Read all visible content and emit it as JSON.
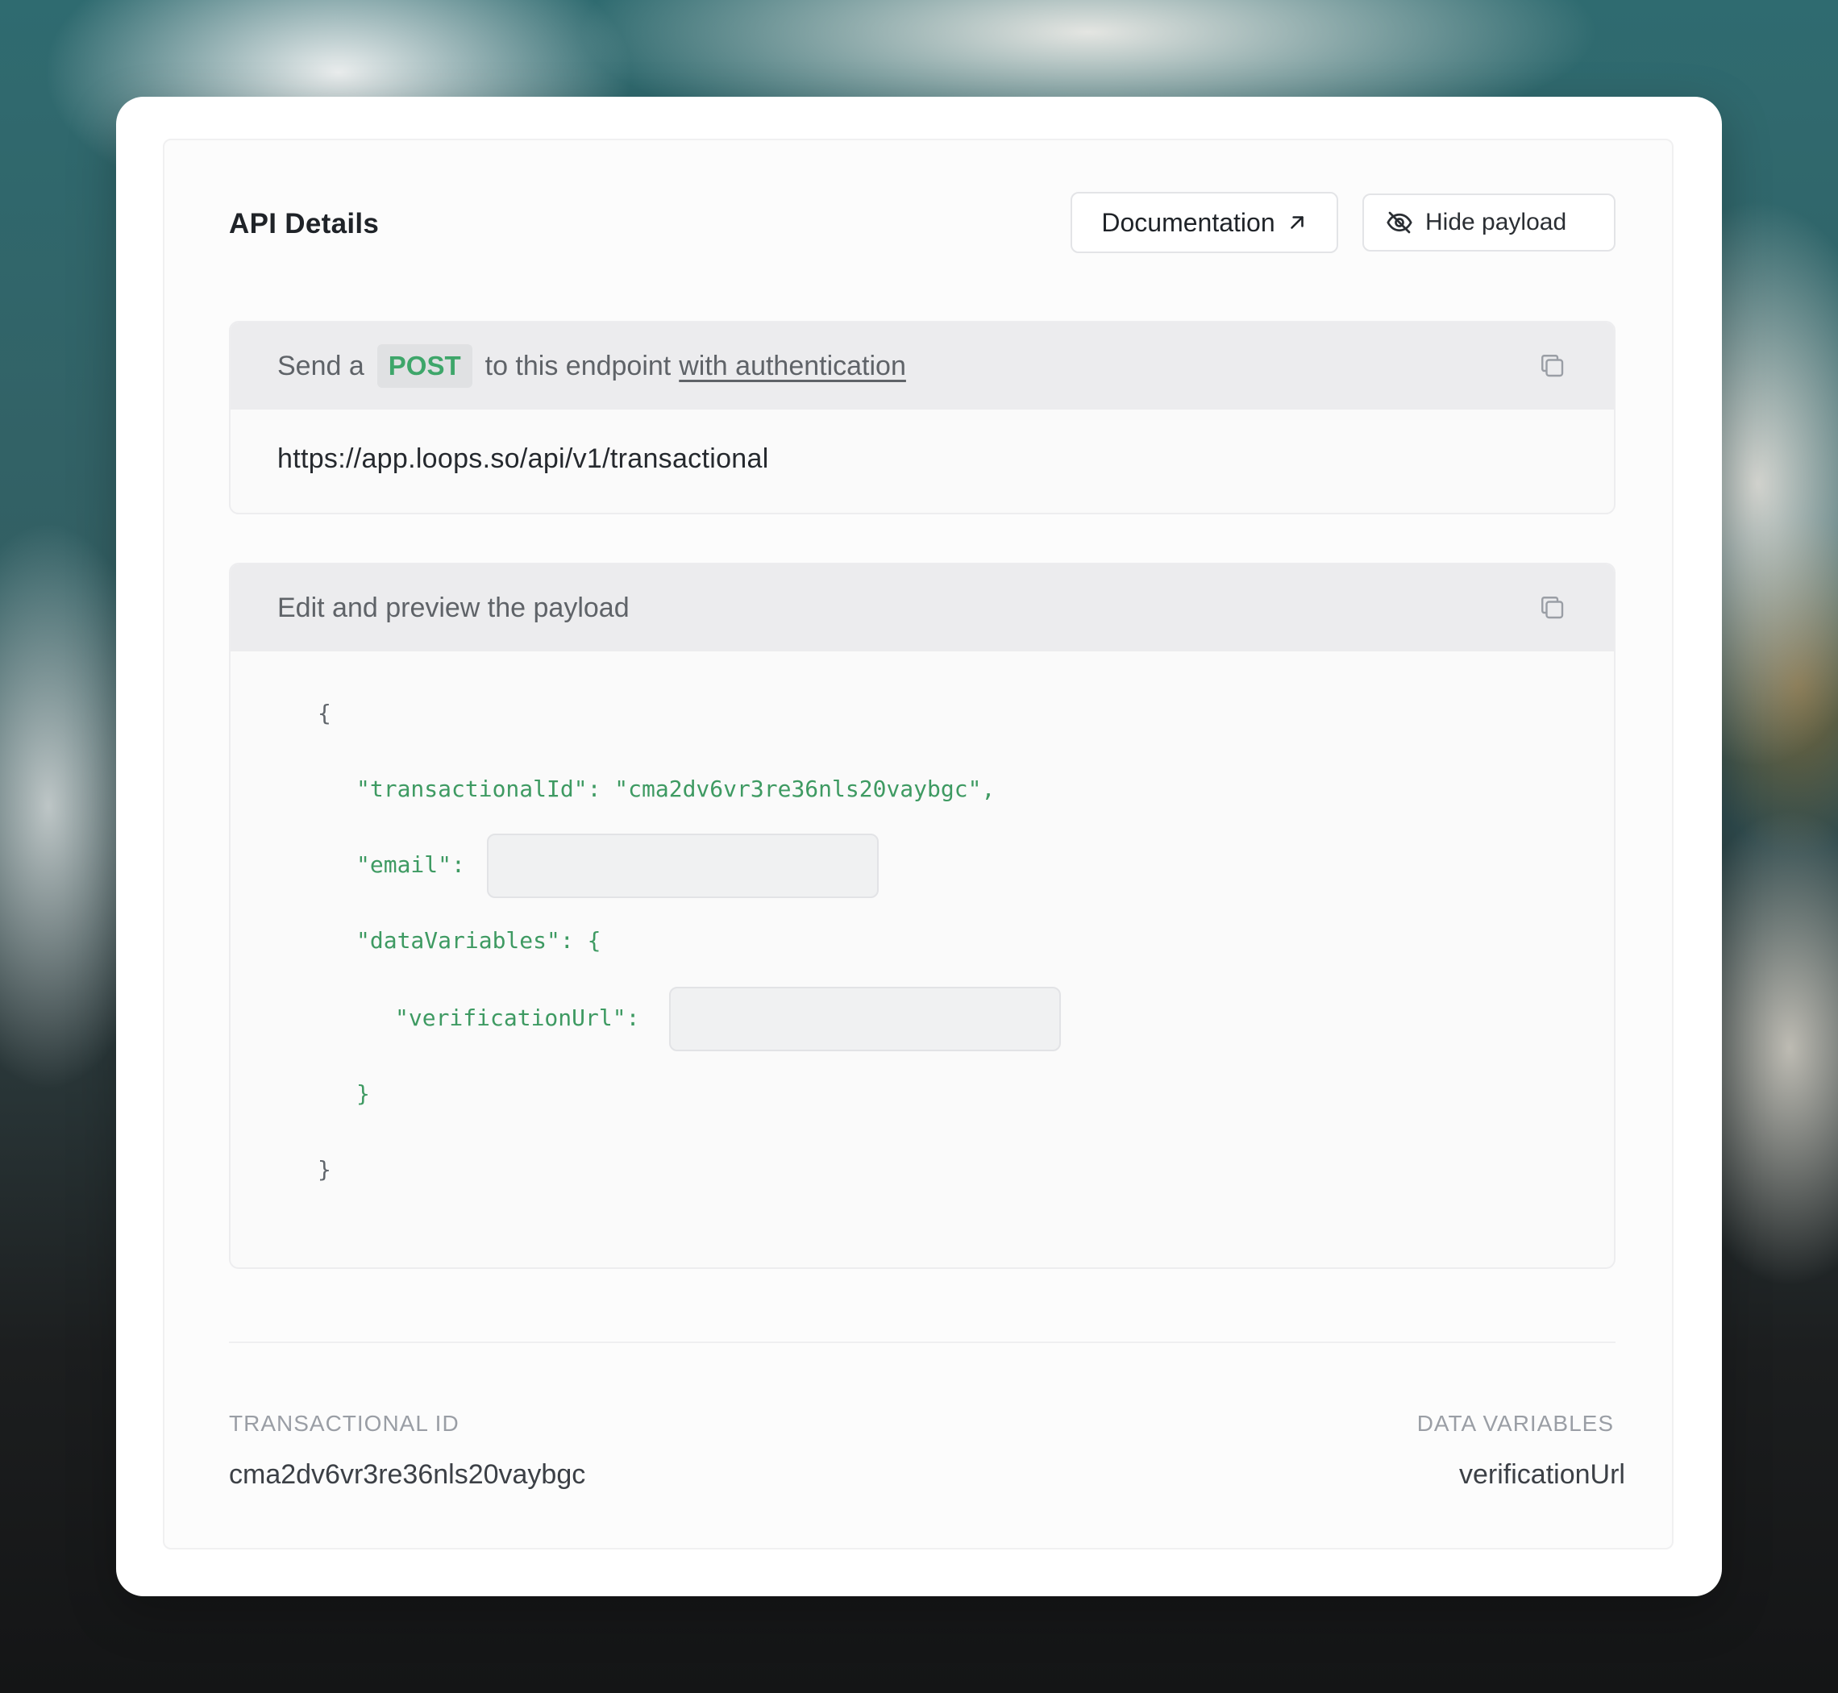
{
  "header": {
    "title": "API Details",
    "documentation_label": "Documentation",
    "hide_payload_label": "Hide payload"
  },
  "endpoint": {
    "prefix": "Send a",
    "method": "POST",
    "middle": "to this endpoint",
    "auth_link": "with authentication",
    "url": "https://app.loops.so/api/v1/transactional"
  },
  "payload": {
    "heading": "Edit and preview the payload",
    "open_brace": "{",
    "transactional_line": "\"transactionalId\": \"cma2dv6vr3re36nls20vaybgc\",",
    "email_key": "\"email\":",
    "email_value": "",
    "data_variables_line": "\"dataVariables\": {",
    "verification_key": "\"verificationUrl\":",
    "verification_value": "",
    "inner_close": "}",
    "close_brace": "}"
  },
  "meta": {
    "transactional_id_label": "TRANSACTIONAL ID",
    "transactional_id_value": "cma2dv6vr3re36nls20vaybgc",
    "data_variables_label": "DATA VARIABLES",
    "data_variables_value": "verificationUrl"
  },
  "colors": {
    "accent_green": "#3ea66a",
    "panel_header": "#ececee"
  },
  "icons": [
    "arrow-up-right-icon",
    "eye-off-icon",
    "copy-icon"
  ]
}
